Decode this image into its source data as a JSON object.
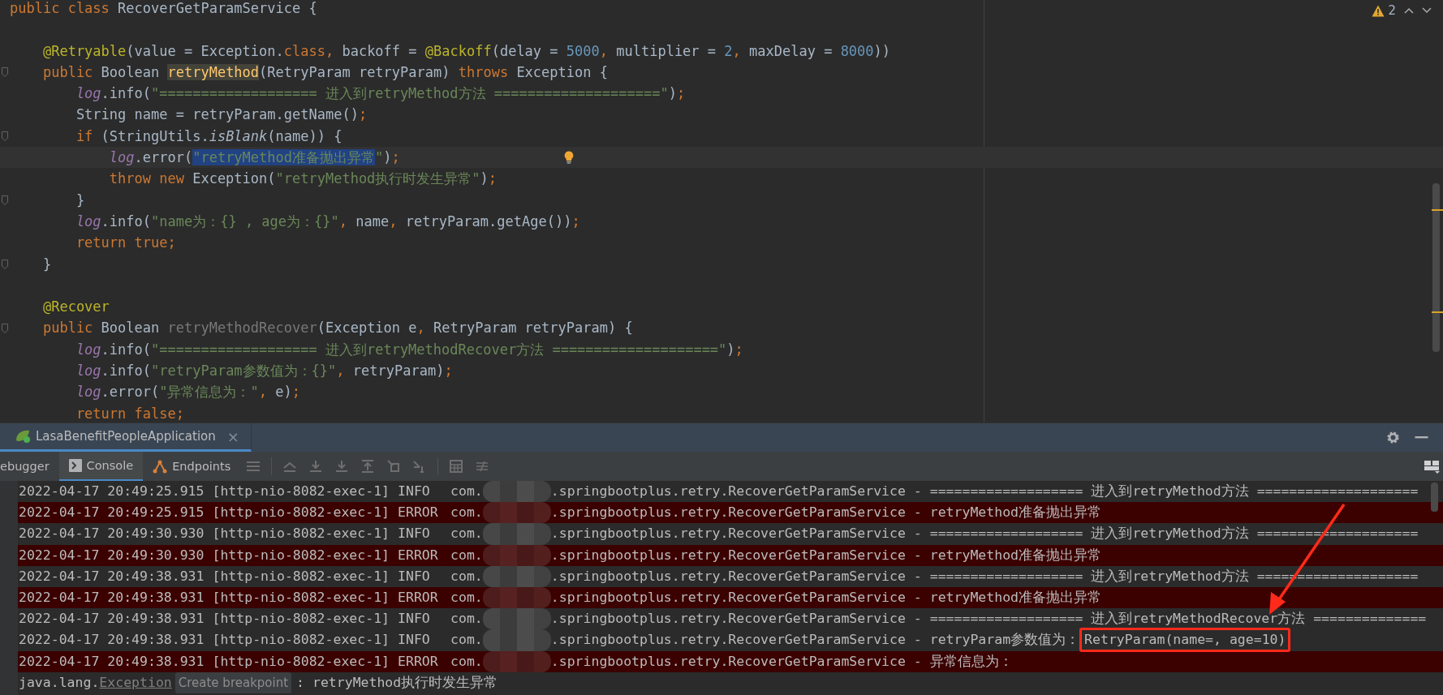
{
  "editor": {
    "warnings": {
      "count": "2"
    },
    "lines": [
      {
        "fold": false,
        "current": false,
        "bulb": false,
        "tokens": [
          {
            "kind": "kw",
            "text": "public class "
          },
          {
            "kind": "plain",
            "text": "RecoverGetParamService {"
          }
        ]
      },
      {
        "fold": false,
        "current": false,
        "bulb": false
      },
      {
        "fold": false,
        "current": false,
        "bulb": false,
        "tokens": [
          {
            "kind": "ann",
            "text": "    @Retryable"
          },
          {
            "kind": "plain",
            "text": "(value = Exception."
          },
          {
            "kind": "kw",
            "text": "class, "
          },
          {
            "kind": "plain",
            "text": "backoff = "
          },
          {
            "kind": "ann",
            "text": "@Backoff"
          },
          {
            "kind": "plain",
            "text": "(delay = "
          },
          {
            "kind": "num",
            "text": "5000"
          },
          {
            "kind": "kw",
            "text": ", "
          },
          {
            "kind": "plain",
            "text": "multiplier = "
          },
          {
            "kind": "num",
            "text": "2"
          },
          {
            "kind": "kw",
            "text": ", "
          },
          {
            "kind": "plain",
            "text": "maxDelay = "
          },
          {
            "kind": "num",
            "text": "8000"
          },
          {
            "kind": "plain",
            "text": "))"
          }
        ]
      },
      {
        "fold": true,
        "current": false,
        "bulb": false,
        "tokens": [
          {
            "kind": "kw",
            "text": "    public "
          },
          {
            "kind": "plain",
            "text": "Boolean "
          },
          {
            "kind": "decl",
            "text": "retryMethod"
          },
          {
            "kind": "plain",
            "text": "(RetryParam retryParam) "
          },
          {
            "kind": "kw",
            "text": "throws "
          },
          {
            "kind": "plain",
            "text": "Exception {"
          }
        ]
      },
      {
        "fold": false,
        "current": false,
        "bulb": false,
        "tokens": [
          {
            "kind": "field",
            "text": "        log"
          },
          {
            "kind": "plain",
            "text": ".info("
          },
          {
            "kind": "str",
            "text": "\"=================== 进入到retryMethod方法 ====================\""
          },
          {
            "kind": "plain",
            "text": ")"
          },
          {
            "kind": "kw",
            "text": ";"
          }
        ]
      },
      {
        "fold": false,
        "current": false,
        "bulb": false,
        "tokens": [
          {
            "kind": "plain",
            "text": "        String name = retryParam.getName()"
          },
          {
            "kind": "kw",
            "text": ";"
          }
        ]
      },
      {
        "fold": true,
        "current": false,
        "bulb": false,
        "tokens": [
          {
            "kind": "kw",
            "text": "        if "
          },
          {
            "kind": "plain",
            "text": "(StringUtils."
          },
          {
            "kind": "static",
            "text": "isBlank"
          },
          {
            "kind": "plain",
            "text": "(name)) {"
          }
        ]
      },
      {
        "fold": false,
        "current": true,
        "bulb": true,
        "tokens": [
          {
            "kind": "field",
            "text": "            log"
          },
          {
            "kind": "plain",
            "text": ".error("
          },
          {
            "kind": "sel",
            "text": "\"retryMethod准备抛出异常"
          },
          {
            "kind": "str",
            "text": "\""
          },
          {
            "kind": "plain",
            "text": ")"
          },
          {
            "kind": "kw",
            "text": ";"
          }
        ]
      },
      {
        "fold": false,
        "current": false,
        "bulb": false,
        "tokens": [
          {
            "kind": "kw",
            "text": "            throw new "
          },
          {
            "kind": "plain",
            "text": "Exception("
          },
          {
            "kind": "str",
            "text": "\"retryMethod执行时发生异常\""
          },
          {
            "kind": "plain",
            "text": ")"
          },
          {
            "kind": "kw",
            "text": ";"
          }
        ]
      },
      {
        "fold": true,
        "current": false,
        "bulb": false,
        "tokens": [
          {
            "kind": "plain",
            "text": "        }"
          }
        ]
      },
      {
        "fold": false,
        "current": false,
        "bulb": false,
        "tokens": [
          {
            "kind": "field",
            "text": "        log"
          },
          {
            "kind": "plain",
            "text": ".info("
          },
          {
            "kind": "str",
            "text": "\"name为：{} , age为：{}\""
          },
          {
            "kind": "kw",
            "text": ", "
          },
          {
            "kind": "plain",
            "text": "name"
          },
          {
            "kind": "kw",
            "text": ", "
          },
          {
            "kind": "plain",
            "text": "retryParam.getAge())"
          },
          {
            "kind": "kw",
            "text": ";"
          }
        ]
      },
      {
        "fold": false,
        "current": false,
        "bulb": false,
        "tokens": [
          {
            "kind": "kw",
            "text": "        return true;"
          }
        ]
      },
      {
        "fold": true,
        "current": false,
        "bulb": false,
        "tokens": [
          {
            "kind": "plain",
            "text": "    }"
          }
        ]
      },
      {
        "fold": false,
        "current": false,
        "bulb": false
      },
      {
        "fold": false,
        "current": false,
        "bulb": false,
        "tokens": [
          {
            "kind": "ann",
            "text": "    @Recover"
          }
        ]
      },
      {
        "fold": true,
        "current": false,
        "bulb": false,
        "tokens": [
          {
            "kind": "kw",
            "text": "    public "
          },
          {
            "kind": "plain",
            "text": "Boolean "
          },
          {
            "kind": "unused",
            "text": "retryMethodRecover"
          },
          {
            "kind": "plain",
            "text": "(Exception e"
          },
          {
            "kind": "kw",
            "text": ", "
          },
          {
            "kind": "plain",
            "text": "RetryParam retryParam) {"
          }
        ]
      },
      {
        "fold": false,
        "current": false,
        "bulb": false,
        "tokens": [
          {
            "kind": "field",
            "text": "        log"
          },
          {
            "kind": "plain",
            "text": ".info("
          },
          {
            "kind": "str",
            "text": "\"=================== 进入到retryMethodRecover方法 ====================\""
          },
          {
            "kind": "plain",
            "text": ")"
          },
          {
            "kind": "kw",
            "text": ";"
          }
        ]
      },
      {
        "fold": false,
        "current": false,
        "bulb": false,
        "tokens": [
          {
            "kind": "field",
            "text": "        log"
          },
          {
            "kind": "plain",
            "text": ".info("
          },
          {
            "kind": "str",
            "text": "\"retryParam参数值为：{}\""
          },
          {
            "kind": "kw",
            "text": ", "
          },
          {
            "kind": "plain",
            "text": "retryParam)"
          },
          {
            "kind": "kw",
            "text": ";"
          }
        ]
      },
      {
        "fold": false,
        "current": false,
        "bulb": false,
        "tokens": [
          {
            "kind": "field",
            "text": "        log"
          },
          {
            "kind": "plain",
            "text": ".error("
          },
          {
            "kind": "str",
            "text": "\"异常信息为：\""
          },
          {
            "kind": "kw",
            "text": ", "
          },
          {
            "kind": "plain",
            "text": "e)"
          },
          {
            "kind": "kw",
            "text": ";"
          }
        ]
      },
      {
        "fold": false,
        "current": false,
        "bulb": false,
        "tokens": [
          {
            "kind": "kw",
            "text": "        return false;"
          }
        ]
      }
    ]
  },
  "run_panel": {
    "tabs": [
      {
        "label": "LasaBenefitPeopleApplication",
        "close": "×",
        "selected": true
      }
    ],
    "toolbar_tabs": [
      {
        "label": "ebugger",
        "selected": false
      },
      {
        "label": "Console",
        "selected": true
      },
      {
        "label": "Endpoints",
        "selected": false
      }
    ]
  },
  "console": {
    "rows": [
      {
        "error": false,
        "time": "2022-04-17 20:49:25.915",
        "thread": "[http-nio-8082-exec-1]",
        "severity": "INFO",
        "pkg": "com.",
        "logger": ".springbootplus.retry.RecoverGetParamService -",
        "message": "=================== 进入到retryMethod方法 ===================="
      },
      {
        "error": true,
        "time": "2022-04-17 20:49:25.915",
        "thread": "[http-nio-8082-exec-1]",
        "severity": "ERROR",
        "pkg": "com.",
        "logger": ".springbootplus.retry.RecoverGetParamService -",
        "message": "retryMethod准备抛出异常"
      },
      {
        "error": false,
        "time": "2022-04-17 20:49:30.930",
        "thread": "[http-nio-8082-exec-1]",
        "severity": "INFO",
        "pkg": "com.",
        "logger": ".springbootplus.retry.RecoverGetParamService -",
        "message": "=================== 进入到retryMethod方法 ===================="
      },
      {
        "error": true,
        "time": "2022-04-17 20:49:30.930",
        "thread": "[http-nio-8082-exec-1]",
        "severity": "ERROR",
        "pkg": "com.",
        "logger": ".springbootplus.retry.RecoverGetParamService -",
        "message": "retryMethod准备抛出异常"
      },
      {
        "error": false,
        "time": "2022-04-17 20:49:38.931",
        "thread": "[http-nio-8082-exec-1]",
        "severity": "INFO",
        "pkg": "com.",
        "logger": ".springbootplus.retry.RecoverGetParamService -",
        "message": "=================== 进入到retryMethod方法 ===================="
      },
      {
        "error": true,
        "time": "2022-04-17 20:49:38.931",
        "thread": "[http-nio-8082-exec-1]",
        "severity": "ERROR",
        "pkg": "com.",
        "logger": ".springbootplus.retry.RecoverGetParamService -",
        "message": "retryMethod准备抛出异常"
      },
      {
        "error": false,
        "time": "2022-04-17 20:49:38.931",
        "thread": "[http-nio-8082-exec-1]",
        "severity": "INFO",
        "pkg": "com.",
        "logger": ".springbootplus.retry.RecoverGetParamService -",
        "message": "=================== 进入到retryMethodRecover方法 =============="
      },
      {
        "error": false,
        "time": "2022-04-17 20:49:38.931",
        "thread": "[http-nio-8082-exec-1]",
        "severity": "INFO",
        "pkg": "com.",
        "logger": ".springbootplus.retry.RecoverGetParamService -",
        "message": "retryParam参数值为：",
        "boxed": "RetryParam(name=, age=10)"
      },
      {
        "error": true,
        "time": "2022-04-17 20:49:38.931",
        "thread": "[http-nio-8082-exec-1]",
        "severity": "ERROR",
        "pkg": "com.",
        "logger": ".springbootplus.retry.RecoverGetParamService -",
        "message": "异常信息为："
      }
    ],
    "exception": {
      "prefix": "java.lang.",
      "link": "Exception",
      "hint": "Create breakpoint",
      "message": ": retryMethod执行时发生异常"
    }
  }
}
